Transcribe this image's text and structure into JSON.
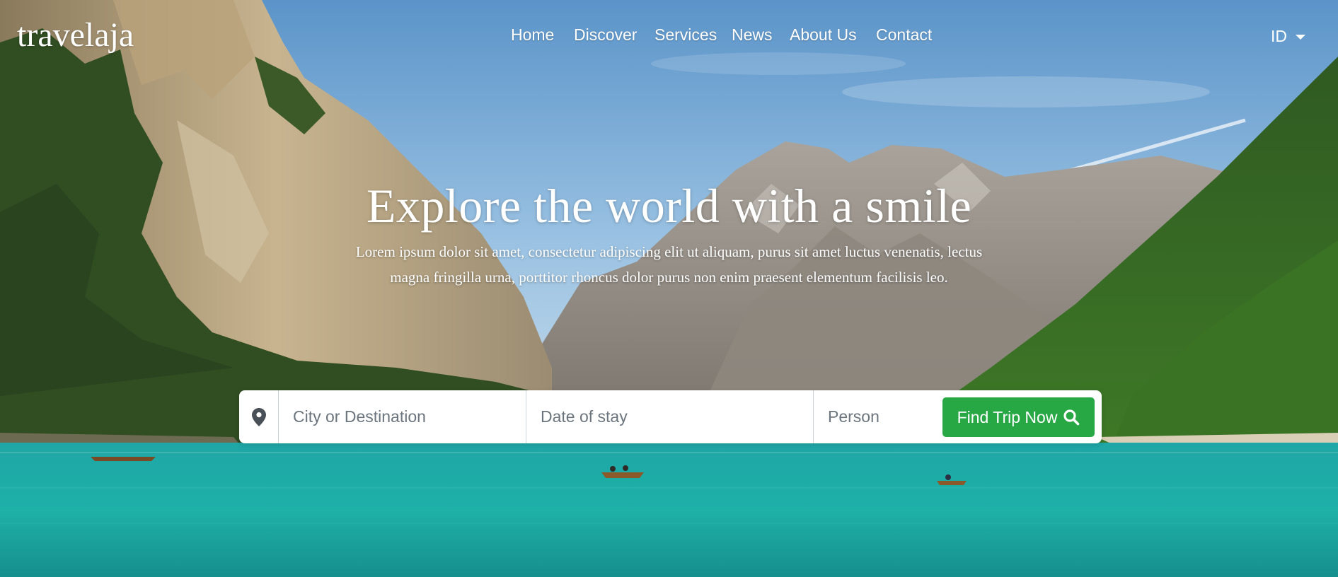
{
  "brand": {
    "name": "travelaja"
  },
  "nav": {
    "items": [
      {
        "label": "Home"
      },
      {
        "label": "Discover"
      },
      {
        "label": "Services"
      },
      {
        "label": "News"
      },
      {
        "label": "About Us"
      },
      {
        "label": "Contact"
      }
    ]
  },
  "language": {
    "selected": "ID",
    "icon": "caret-down-icon"
  },
  "hero": {
    "headline": "Explore the world with a smile",
    "lead_line1": "Lorem ipsum dolor sit amet, consectetur adipiscing elit ut aliquam, purus sit amet luctus venenatis, lectus",
    "lead_line2": "magna fringilla urna, porttitor rhoncus dolor purus non enim praesent elementum facilisis leo."
  },
  "search": {
    "location_icon": "map-marker-icon",
    "city_placeholder": "City or Destination",
    "date_placeholder": "Date of stay",
    "person_placeholder": "Person",
    "button_label": "Find Trip Now",
    "button_icon": "search-icon",
    "button_color": "#28a745"
  }
}
